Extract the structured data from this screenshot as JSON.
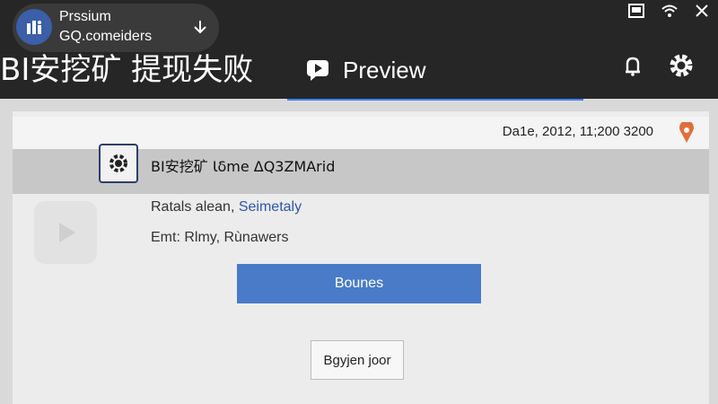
{
  "notification": {
    "line1": "Prssium",
    "line2": "GQ.comeiders"
  },
  "header": {
    "app_title": "BI安挖矿 提现失败",
    "tab_label": "Preview"
  },
  "card": {
    "date_text": "Da1e, 2012, 11;200 3200",
    "row_title": "BI安挖矿 Ɩδme ΔQ3ZMΑrid",
    "line1_prefix": "Ratals alean, ",
    "line1_link": "Seimetaly",
    "line2": "Emt: Rlmy, Rùnawers",
    "primary_button": "Bounes",
    "secondary_button": "Bgyjen joor"
  },
  "colors": {
    "accent": "#4a7bc8",
    "pin": "#e0703a",
    "header_bg": "#262626"
  },
  "icons": [
    "app-icon",
    "download-icon",
    "screenshot-icon",
    "wifi-icon",
    "close-icon",
    "preview-icon",
    "bell-icon",
    "gear-icon",
    "settings-icon",
    "pin-icon"
  ]
}
